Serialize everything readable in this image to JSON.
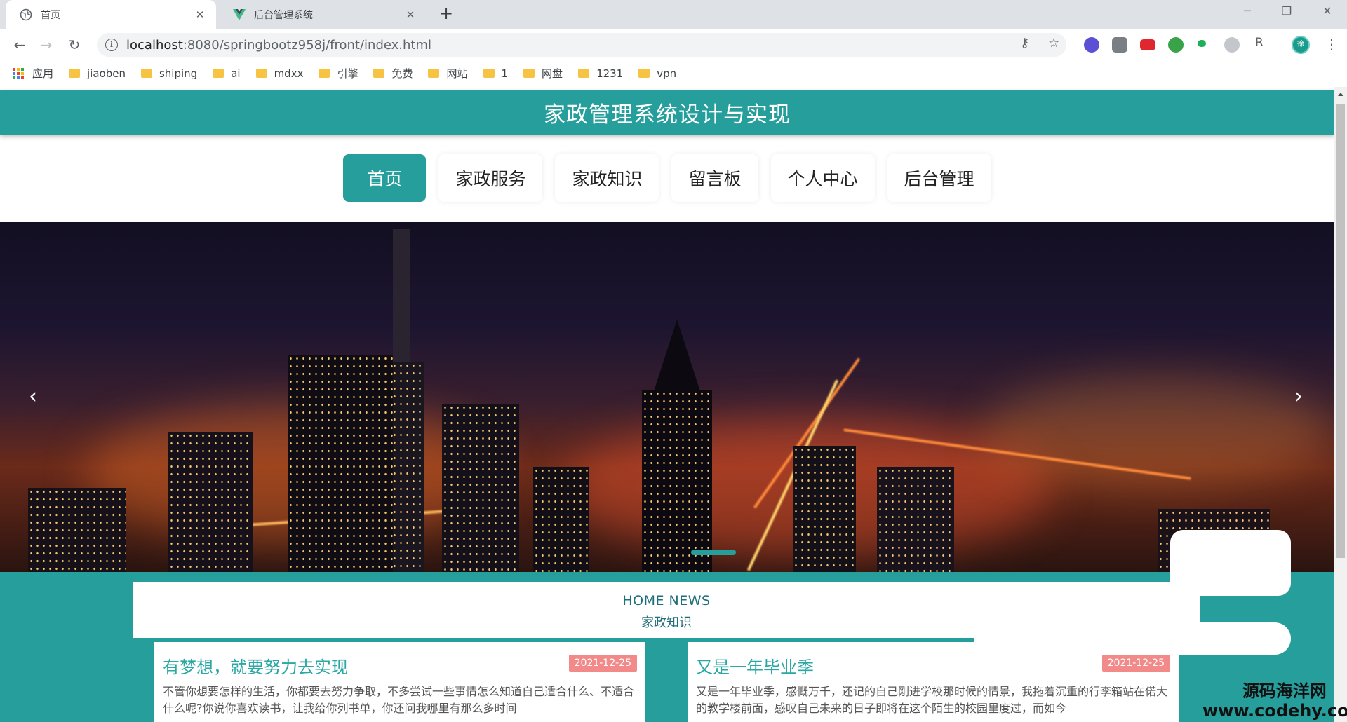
{
  "browser": {
    "tabs": [
      {
        "title": "首页",
        "active": true,
        "icon": "globe-icon"
      },
      {
        "title": "后台管理系统",
        "active": false,
        "icon": "vue-logo-icon"
      }
    ],
    "new_tab": "+",
    "url_host": "localhost",
    "url_rest": ":8080/springbootz958j/front/index.html",
    "info_glyph": "i",
    "ext_letter": "R",
    "profile_initial": "徐",
    "bookmarks": [
      {
        "label": "应用",
        "type": "apps"
      },
      {
        "label": "jiaoben",
        "type": "folder"
      },
      {
        "label": "shiping",
        "type": "folder"
      },
      {
        "label": "ai",
        "type": "folder"
      },
      {
        "label": "mdxx",
        "type": "folder"
      },
      {
        "label": "引擎",
        "type": "folder"
      },
      {
        "label": "免费",
        "type": "folder"
      },
      {
        "label": "网站",
        "type": "folder"
      },
      {
        "label": "1",
        "type": "folder"
      },
      {
        "label": "网盘",
        "type": "folder"
      },
      {
        "label": "1231",
        "type": "folder"
      },
      {
        "label": "vpn",
        "type": "folder"
      }
    ]
  },
  "site": {
    "title": "家政管理系统设计与实现",
    "accent": "#269e9b",
    "nav": [
      {
        "label": "首页",
        "active": true
      },
      {
        "label": "家政服务",
        "active": false
      },
      {
        "label": "家政知识",
        "active": false
      },
      {
        "label": "留言板",
        "active": false
      },
      {
        "label": "个人中心",
        "active": false
      },
      {
        "label": "后台管理",
        "active": false
      }
    ],
    "carousel": {
      "prev": "‹",
      "next": "›"
    },
    "news": {
      "heading_en": "HOME NEWS",
      "heading_zh": "家政知识",
      "items": [
        {
          "title": "有梦想，就要努力去实现",
          "date": "2021-12-25",
          "excerpt": "不管你想要怎样的生活，你都要去努力争取，不多尝试一些事情怎么知道自己适合什么、不适合什么呢?你说你喜欢读书，让我给你列书单，你还问我哪里有那么多时间"
        },
        {
          "title": "又是一年毕业季",
          "date": "2021-12-25",
          "excerpt": "又是一年毕业季，感慨万千，还记的自己刚进学校那时候的情景，我拖着沉重的行李箱站在偌大的教学楼前面，感叹自己未来的日子即将在这个陌生的校园里度过，而如今"
        }
      ]
    }
  },
  "watermark": {
    "line1": "源码海洋网",
    "line2": "www.codehy.com"
  }
}
